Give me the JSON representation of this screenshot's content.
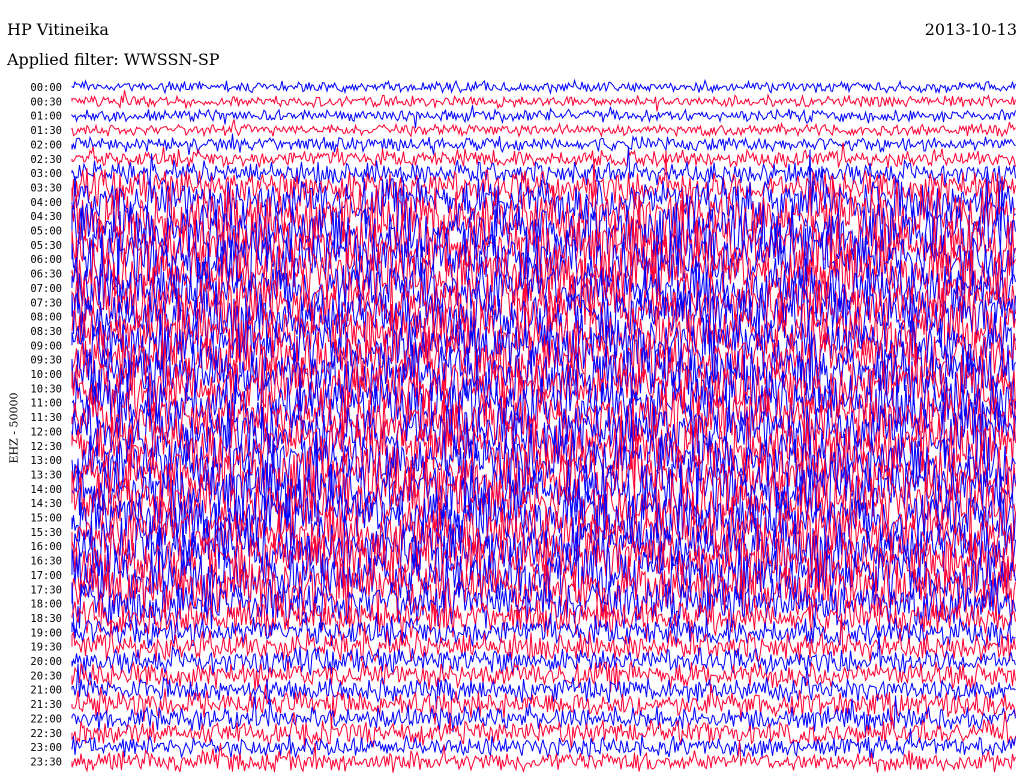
{
  "header": {
    "station": "HP Vitineika",
    "date": "2013-10-13",
    "filter_text": "Applied filter: WWSSN-SP"
  },
  "chart_data": {
    "type": "line",
    "title": "HP Vitineika",
    "subtitle": "Applied filter: WWSSN-SP",
    "ylabel": "EHZ - 50000",
    "xlabel": "",
    "rows": [
      {
        "time": "00:00",
        "color": "blue",
        "amplitude": 0.2
      },
      {
        "time": "00:30",
        "color": "red",
        "amplitude": 0.2
      },
      {
        "time": "01:00",
        "color": "blue",
        "amplitude": 0.2
      },
      {
        "time": "01:30",
        "color": "red",
        "amplitude": 0.2
      },
      {
        "time": "02:00",
        "color": "blue",
        "amplitude": 0.25
      },
      {
        "time": "02:30",
        "color": "red",
        "amplitude": 0.3
      },
      {
        "time": "03:00",
        "color": "blue",
        "amplitude": 0.4
      },
      {
        "time": "03:30",
        "color": "red",
        "amplitude": 0.6
      },
      {
        "time": "04:00",
        "color": "blue",
        "amplitude": 0.8
      },
      {
        "time": "04:30",
        "color": "red",
        "amplitude": 1.0
      },
      {
        "time": "05:00",
        "color": "blue",
        "amplitude": 1.0
      },
      {
        "time": "05:30",
        "color": "red",
        "amplitude": 1.0
      },
      {
        "time": "06:00",
        "color": "blue",
        "amplitude": 1.0
      },
      {
        "time": "06:30",
        "color": "red",
        "amplitude": 1.0
      },
      {
        "time": "07:00",
        "color": "blue",
        "amplitude": 1.0
      },
      {
        "time": "07:30",
        "color": "red",
        "amplitude": 1.0
      },
      {
        "time": "08:00",
        "color": "blue",
        "amplitude": 1.0
      },
      {
        "time": "08:30",
        "color": "red",
        "amplitude": 1.0
      },
      {
        "time": "09:00",
        "color": "blue",
        "amplitude": 1.0
      },
      {
        "time": "09:30",
        "color": "red",
        "amplitude": 1.0
      },
      {
        "time": "10:00",
        "color": "blue",
        "amplitude": 1.0
      },
      {
        "time": "10:30",
        "color": "red",
        "amplitude": 1.0
      },
      {
        "time": "11:00",
        "color": "blue",
        "amplitude": 1.0
      },
      {
        "time": "11:30",
        "color": "red",
        "amplitude": 1.0
      },
      {
        "time": "12:00",
        "color": "blue",
        "amplitude": 1.0
      },
      {
        "time": "12:30",
        "color": "red",
        "amplitude": 1.0
      },
      {
        "time": "13:00",
        "color": "blue",
        "amplitude": 1.0
      },
      {
        "time": "13:30",
        "color": "red",
        "amplitude": 1.0
      },
      {
        "time": "14:00",
        "color": "blue",
        "amplitude": 1.0
      },
      {
        "time": "14:30",
        "color": "red",
        "amplitude": 1.0
      },
      {
        "time": "15:00",
        "color": "blue",
        "amplitude": 1.0
      },
      {
        "time": "15:30",
        "color": "red",
        "amplitude": 1.0
      },
      {
        "time": "16:00",
        "color": "blue",
        "amplitude": 1.0
      },
      {
        "time": "16:30",
        "color": "red",
        "amplitude": 1.0
      },
      {
        "time": "17:00",
        "color": "blue",
        "amplitude": 1.0
      },
      {
        "time": "17:30",
        "color": "red",
        "amplitude": 1.0
      },
      {
        "time": "18:00",
        "color": "blue",
        "amplitude": 0.8
      },
      {
        "time": "18:30",
        "color": "red",
        "amplitude": 0.6
      },
      {
        "time": "19:00",
        "color": "blue",
        "amplitude": 0.5
      },
      {
        "time": "19:30",
        "color": "red",
        "amplitude": 0.5
      },
      {
        "time": "20:00",
        "color": "blue",
        "amplitude": 0.45
      },
      {
        "time": "20:30",
        "color": "red",
        "amplitude": 0.45
      },
      {
        "time": "21:00",
        "color": "blue",
        "amplitude": 0.4
      },
      {
        "time": "21:30",
        "color": "red",
        "amplitude": 0.45
      },
      {
        "time": "22:00",
        "color": "blue",
        "amplitude": 0.4
      },
      {
        "time": "22:30",
        "color": "red",
        "amplitude": 0.4
      },
      {
        "time": "23:00",
        "color": "blue",
        "amplitude": 0.35
      },
      {
        "time": "23:30",
        "color": "red",
        "amplitude": 0.35
      }
    ],
    "colors": {
      "blue": "#0000ff",
      "red": "#ff0033"
    },
    "grid": false
  }
}
